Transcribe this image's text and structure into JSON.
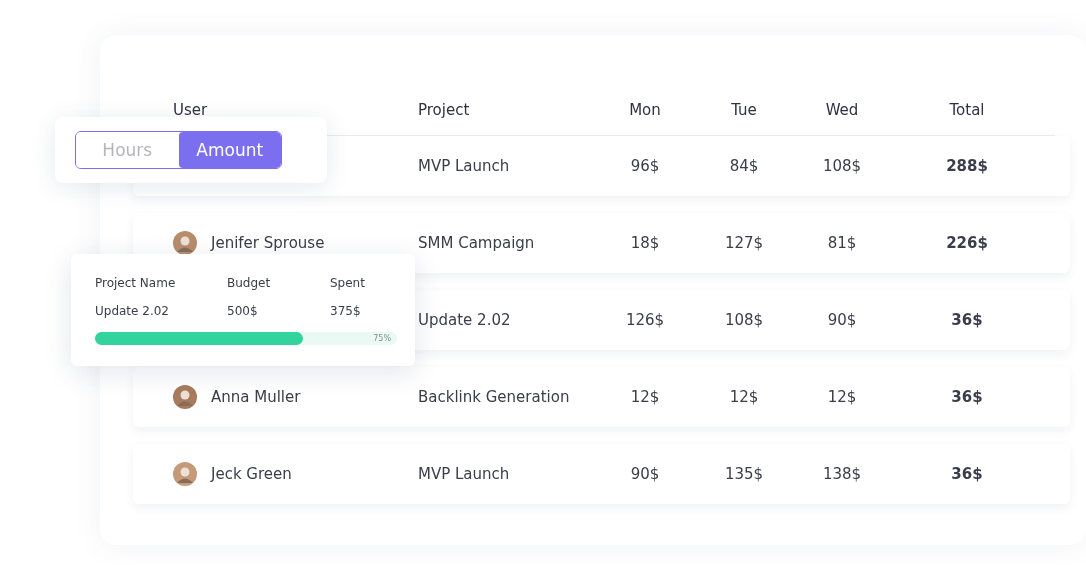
{
  "view_toggle": [
    {
      "label": "Hours",
      "selected": false
    },
    {
      "label": "Amount",
      "selected": true
    }
  ],
  "table": {
    "columns": [
      "User",
      "Project",
      "Mon",
      "Tue",
      "Wed",
      "Total"
    ],
    "rows": [
      {
        "project": "MVP Launch",
        "mon": "96$",
        "tue": "84$",
        "wed": "108$",
        "total": "288$"
      },
      {
        "user": "Jenifer Sprouse",
        "project": "SMM Campaign",
        "mon": "18$",
        "tue": "127$",
        "wed": "81$",
        "total": "226$"
      },
      {
        "project": "Update 2.02",
        "mon": "126$",
        "tue": "108$",
        "wed": "90$",
        "total": "36$"
      },
      {
        "user": "Anna Muller",
        "project": "Backlink Generation",
        "mon": "12$",
        "tue": "12$",
        "wed": "12$",
        "total": "36$"
      },
      {
        "user": "Jeck Green",
        "project": "MVP Launch",
        "mon": "90$",
        "tue": "135$",
        "wed": "138$",
        "total": "36$"
      }
    ]
  },
  "budget_popup": {
    "columns": [
      "Project Name",
      "Budget",
      "Spent"
    ],
    "values": [
      "Update 2.02",
      "500$",
      "375$"
    ],
    "progress": {
      "level": 0.69,
      "reading": "75%"
    }
  }
}
